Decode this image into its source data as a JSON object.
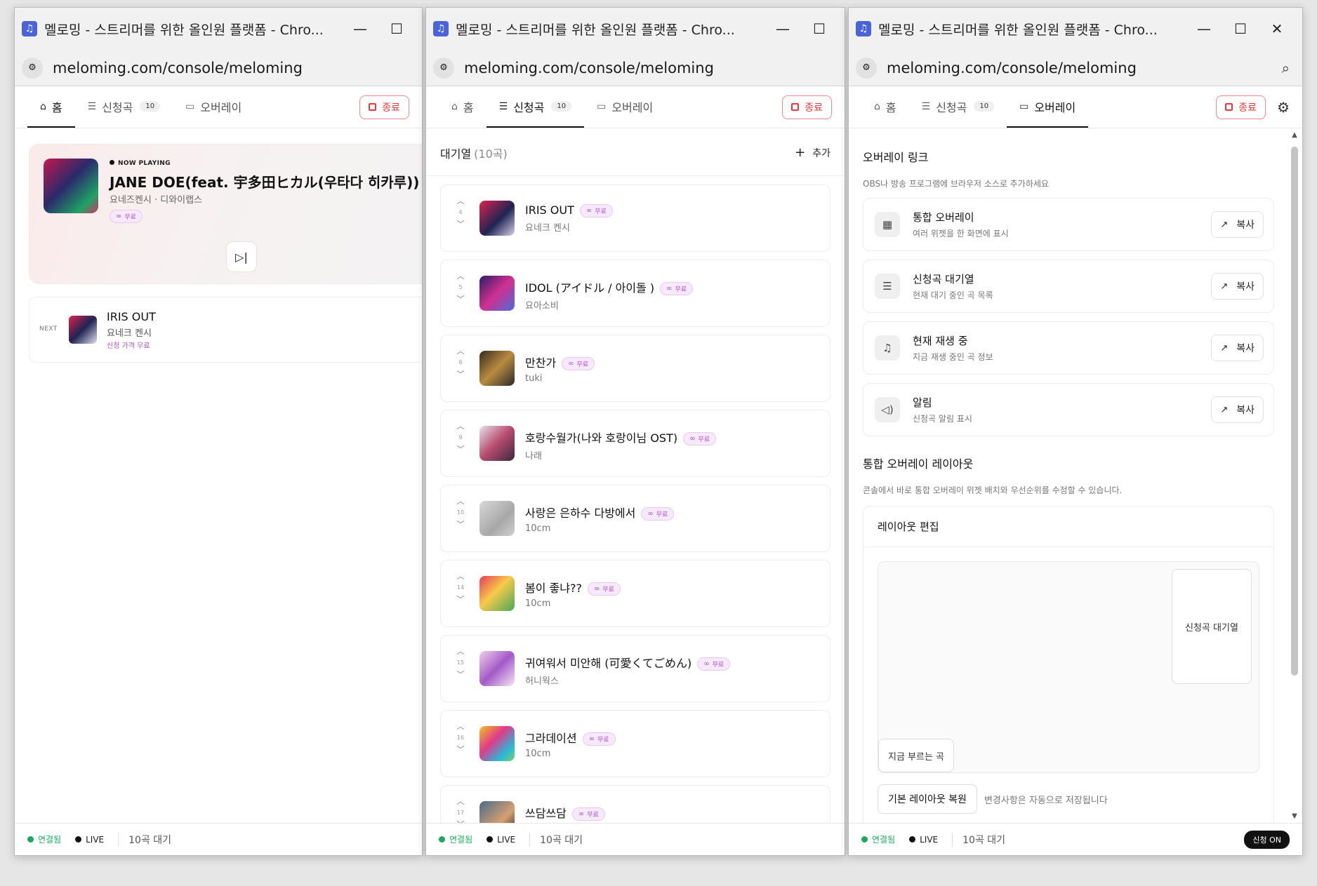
{
  "windows": [
    {
      "title": "멜로밍 - 스트리머를 위한 올인원 플랫폼 - Chro...",
      "url": "meloming.com/console/meloming"
    },
    {
      "title": "멜로밍 - 스트리머를 위한 올인원 플랫폼 - Chro...",
      "url": "meloming.com/console/meloming"
    },
    {
      "title": "멜로밍 - 스트리머를 위한 올인원 플랫폼 - Chro...",
      "url": "meloming.com/console/meloming"
    }
  ],
  "nav": {
    "home": "홈",
    "requests": "신청곡",
    "request_count": "10",
    "overlay": "오버레이",
    "end": "종료"
  },
  "now_playing": {
    "label": "NOW PLAYING",
    "title": "JANE DOE(feat. 宇多田ヒカル(우타다 히카루))",
    "artist": "요네즈켄시 · 디와이랩스",
    "badge": "무료"
  },
  "next": {
    "label": "NEXT",
    "title": "IRIS OUT",
    "artist": "요네크 켄시",
    "price": "신청 가격 무료"
  },
  "queue": {
    "title": "대기열",
    "count": "(10곡)",
    "add": "추가",
    "items": [
      {
        "num": "4",
        "title": "IRIS OUT",
        "artist": "요네크 켄시",
        "badge": "무료"
      },
      {
        "num": "5",
        "title": "IDOL (アイドル / 아이돌 )",
        "artist": "요아소비",
        "badge": "무료"
      },
      {
        "num": "6",
        "title": "만찬가",
        "artist": "tuki",
        "badge": "무료"
      },
      {
        "num": "9",
        "title": "호랑수월가(나와 호랑이님 OST)",
        "artist": "나래",
        "badge": "무료"
      },
      {
        "num": "10",
        "title": "사랑은 은하수 다방에서",
        "artist": "10cm",
        "badge": "무료"
      },
      {
        "num": "14",
        "title": "봄이 좋냐??",
        "artist": "10cm",
        "badge": "무료"
      },
      {
        "num": "15",
        "title": "귀여워서 미안해 (可愛くてごめん)",
        "artist": "허니웍스",
        "badge": "무료"
      },
      {
        "num": "16",
        "title": "그라데이션",
        "artist": "10cm",
        "badge": "무료"
      },
      {
        "num": "17",
        "title": "쓰담쓰담",
        "artist": "",
        "badge": "무료"
      }
    ]
  },
  "overlay": {
    "section_title": "오버레이 링크",
    "section_desc": "OBS나 방송 프로그램에 브라우저 소스로 추가하세요",
    "copy": "복사",
    "items": [
      {
        "title": "통합 오버레이",
        "desc": "여러 위젯을 한 화면에 표시",
        "icon": "grid-icon"
      },
      {
        "title": "신청곡 대기열",
        "desc": "현재 대기 중인 곡 목록",
        "icon": "queue-icon"
      },
      {
        "title": "현재 재생 중",
        "desc": "지금 재생 중인 곡 정보",
        "icon": "music-note-icon"
      },
      {
        "title": "알림",
        "desc": "신청곡 알림 표시",
        "icon": "speaker-icon"
      }
    ],
    "layout_title": "통합 오버레이 레이아웃",
    "layout_desc": "콘솔에서 바로 통합 오버레이 위젯 배치와 우선순위를 수정할 수 있습니다.",
    "layout_edit": "레이아웃 편집",
    "widget_queue": "신청곡 대기열",
    "widget_now": "지금 부르는 곡",
    "reset": "기본 레이아웃 복원",
    "autosave": "변경사항은 자동으로 저장됩니다"
  },
  "status": {
    "connected": "연결됨",
    "live": "LIVE",
    "queue": "10곡 대기",
    "requests_on": "신청 ON"
  },
  "colors": {
    "accent_free": "#b04fc9",
    "danger": "#e23b3b",
    "connected": "#1aa95b"
  }
}
